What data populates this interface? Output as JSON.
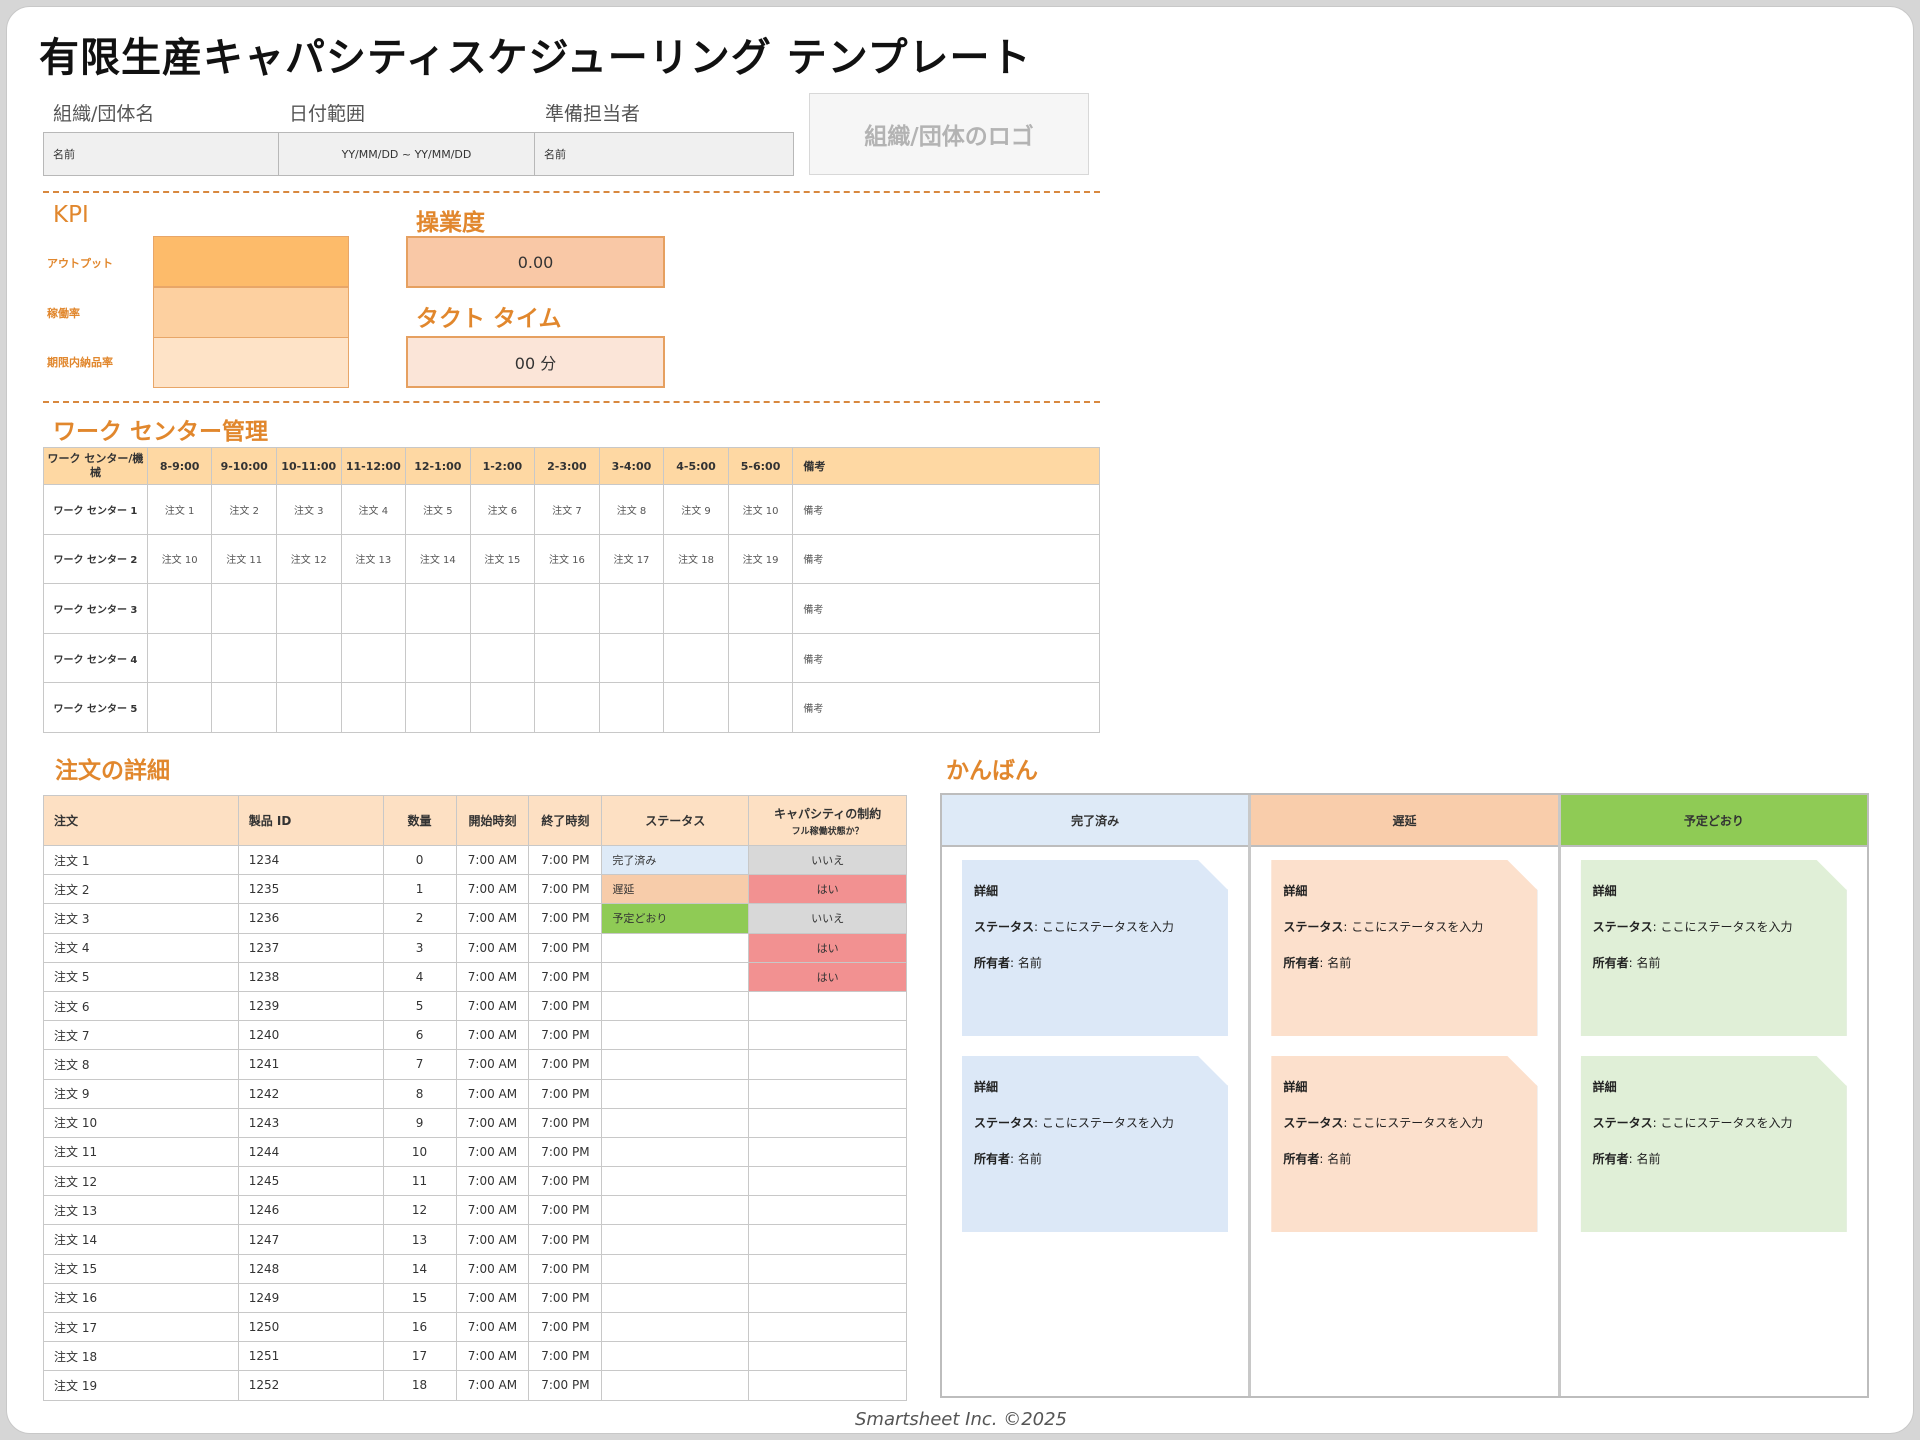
{
  "title": "有限生産キャパシティスケジューリング テンプレート",
  "header": {
    "org_label": "組織/団体名",
    "date_label": "日付範囲",
    "prep_label": "準備担当者",
    "org_value": "名前",
    "date_value": "YY/MM/DD ~ YY/MM/DD",
    "prep_value": "名前",
    "logo_text": "組織/団体のロゴ"
  },
  "kpi": {
    "title": "KPI",
    "labels": [
      "アウトプット",
      "稼働率",
      "期限内納品率"
    ],
    "colors": [
      "#fdbb6a",
      "#fdd0a0",
      "#fee3c7"
    ]
  },
  "utilization": {
    "title": "操業度",
    "value": "0.00"
  },
  "takt": {
    "title": "タクト タイム",
    "value": "00 分"
  },
  "work_center": {
    "title": "ワーク センター管理",
    "header_first": "ワーク センター/機械",
    "time_slots": [
      "8-9:00",
      "9-10:00",
      "10-11:00",
      "11-12:00",
      "12-1:00",
      "1-2:00",
      "2-3:00",
      "3-4:00",
      "4-5:00",
      "5-6:00"
    ],
    "notes_header": "備考",
    "rows": [
      {
        "name": "ワーク センター 1",
        "cells": [
          "注文 1",
          "注文 2",
          "注文 3",
          "注文 4",
          "注文 5",
          "注文 6",
          "注文 7",
          "注文 8",
          "注文 9",
          "注文 10"
        ],
        "note": "備考"
      },
      {
        "name": "ワーク センター 2",
        "cells": [
          "注文 10",
          "注文 11",
          "注文 12",
          "注文 13",
          "注文 14",
          "注文 15",
          "注文 16",
          "注文 17",
          "注文 18",
          "注文 19"
        ],
        "note": "備考"
      },
      {
        "name": "ワーク センター 3",
        "cells": [
          "",
          "",
          "",
          "",
          "",
          "",
          "",
          "",
          "",
          ""
        ],
        "note": "備考"
      },
      {
        "name": "ワーク センター 4",
        "cells": [
          "",
          "",
          "",
          "",
          "",
          "",
          "",
          "",
          "",
          ""
        ],
        "note": "備考"
      },
      {
        "name": "ワーク センター 5",
        "cells": [
          "",
          "",
          "",
          "",
          "",
          "",
          "",
          "",
          "",
          ""
        ],
        "note": "備考"
      }
    ]
  },
  "orders": {
    "title": "注文の詳細",
    "headers": [
      "注文",
      "製品 ID",
      "数量",
      "開始時刻",
      "終了時刻",
      "ステータス",
      "キャパシティの制約",
      "フル稼働状態か？"
    ],
    "rows": [
      {
        "order": "注文 1",
        "pid": "1234",
        "qty": "0",
        "start": "7:00 AM",
        "end": "7:00 PM",
        "status": "完了済み",
        "status_type": "done",
        "cap": "いいえ",
        "cap_type": "no"
      },
      {
        "order": "注文 2",
        "pid": "1235",
        "qty": "1",
        "start": "7:00 AM",
        "end": "7:00 PM",
        "status": "遅延",
        "status_type": "late",
        "cap": "はい",
        "cap_type": "yes"
      },
      {
        "order": "注文 3",
        "pid": "1236",
        "qty": "2",
        "start": "7:00 AM",
        "end": "7:00 PM",
        "status": "予定どおり",
        "status_type": "ontime",
        "cap": "いいえ",
        "cap_type": "no"
      },
      {
        "order": "注文 4",
        "pid": "1237",
        "qty": "3",
        "start": "7:00 AM",
        "end": "7:00 PM",
        "status": "",
        "status_type": "",
        "cap": "はい",
        "cap_type": "yes"
      },
      {
        "order": "注文 5",
        "pid": "1238",
        "qty": "4",
        "start": "7:00 AM",
        "end": "7:00 PM",
        "status": "",
        "status_type": "",
        "cap": "はい",
        "cap_type": "yes"
      },
      {
        "order": "注文 6",
        "pid": "1239",
        "qty": "5",
        "start": "7:00 AM",
        "end": "7:00 PM",
        "status": "",
        "status_type": "",
        "cap": "",
        "cap_type": ""
      },
      {
        "order": "注文 7",
        "pid": "1240",
        "qty": "6",
        "start": "7:00 AM",
        "end": "7:00 PM",
        "status": "",
        "status_type": "",
        "cap": "",
        "cap_type": ""
      },
      {
        "order": "注文 8",
        "pid": "1241",
        "qty": "7",
        "start": "7:00 AM",
        "end": "7:00 PM",
        "status": "",
        "status_type": "",
        "cap": "",
        "cap_type": ""
      },
      {
        "order": "注文 9",
        "pid": "1242",
        "qty": "8",
        "start": "7:00 AM",
        "end": "7:00 PM",
        "status": "",
        "status_type": "",
        "cap": "",
        "cap_type": ""
      },
      {
        "order": "注文 10",
        "pid": "1243",
        "qty": "9",
        "start": "7:00 AM",
        "end": "7:00 PM",
        "status": "",
        "status_type": "",
        "cap": "",
        "cap_type": ""
      },
      {
        "order": "注文 11",
        "pid": "1244",
        "qty": "10",
        "start": "7:00 AM",
        "end": "7:00 PM",
        "status": "",
        "status_type": "",
        "cap": "",
        "cap_type": ""
      },
      {
        "order": "注文 12",
        "pid": "1245",
        "qty": "11",
        "start": "7:00 AM",
        "end": "7:00 PM",
        "status": "",
        "status_type": "",
        "cap": "",
        "cap_type": ""
      },
      {
        "order": "注文 13",
        "pid": "1246",
        "qty": "12",
        "start": "7:00 AM",
        "end": "7:00 PM",
        "status": "",
        "status_type": "",
        "cap": "",
        "cap_type": ""
      },
      {
        "order": "注文 14",
        "pid": "1247",
        "qty": "13",
        "start": "7:00 AM",
        "end": "7:00 PM",
        "status": "",
        "status_type": "",
        "cap": "",
        "cap_type": ""
      },
      {
        "order": "注文 15",
        "pid": "1248",
        "qty": "14",
        "start": "7:00 AM",
        "end": "7:00 PM",
        "status": "",
        "status_type": "",
        "cap": "",
        "cap_type": ""
      },
      {
        "order": "注文 16",
        "pid": "1249",
        "qty": "15",
        "start": "7:00 AM",
        "end": "7:00 PM",
        "status": "",
        "status_type": "",
        "cap": "",
        "cap_type": ""
      },
      {
        "order": "注文 17",
        "pid": "1250",
        "qty": "16",
        "start": "7:00 AM",
        "end": "7:00 PM",
        "status": "",
        "status_type": "",
        "cap": "",
        "cap_type": ""
      },
      {
        "order": "注文 18",
        "pid": "1251",
        "qty": "17",
        "start": "7:00 AM",
        "end": "7:00 PM",
        "status": "",
        "status_type": "",
        "cap": "",
        "cap_type": ""
      },
      {
        "order": "注文 19",
        "pid": "1252",
        "qty": "18",
        "start": "7:00 AM",
        "end": "7:00 PM",
        "status": "",
        "status_type": "",
        "cap": "",
        "cap_type": ""
      }
    ]
  },
  "kanban": {
    "title": "かんばん",
    "columns": [
      {
        "name": "完了済み",
        "color": "#deeaf7",
        "cards": [
          {
            "title": "詳細",
            "status_label": "ステータス",
            "status_text": ": ここにステータスを入力",
            "owner_label": "所有者",
            "owner_text": ": 名前"
          },
          {
            "title": "詳細",
            "status_label": "ステータス",
            "status_text": ": ここにステータスを入力",
            "owner_label": "所有者",
            "owner_text": ": 名前"
          }
        ]
      },
      {
        "name": "遅延",
        "color": "#f9cdab",
        "cards": [
          {
            "title": "詳細",
            "status_label": "ステータス",
            "status_text": ": ここにステータスを入力",
            "owner_label": "所有者",
            "owner_text": ": 名前"
          },
          {
            "title": "詳細",
            "status_label": "ステータス",
            "status_text": ": ここにステータスを入力",
            "owner_label": "所有者",
            "owner_text": ": 名前"
          }
        ]
      },
      {
        "name": "予定どおり",
        "color": "#8fcb55",
        "cards": [
          {
            "title": "詳細",
            "status_label": "ステータス",
            "status_text": ": ここにステータスを入力",
            "owner_label": "所有者",
            "owner_text": ": 名前"
          },
          {
            "title": "詳細",
            "status_label": "ステータス",
            "status_text": ": ここにステータスを入力",
            "owner_label": "所有者",
            "owner_text": ": 名前"
          }
        ]
      }
    ]
  },
  "footer": "Smartsheet Inc. ©2025"
}
